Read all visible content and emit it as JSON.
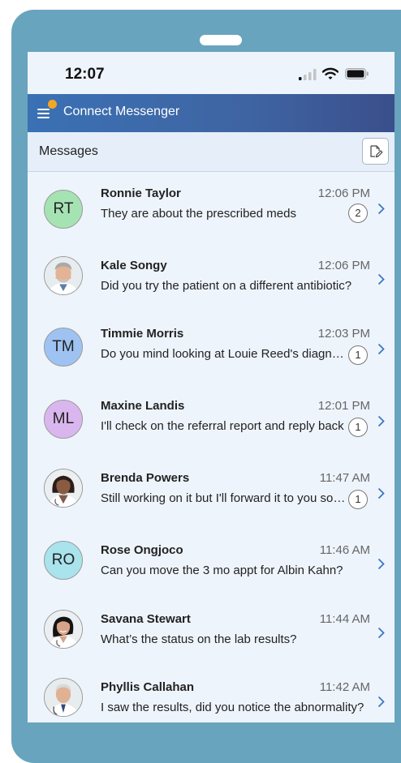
{
  "status_bar": {
    "time": "12:07"
  },
  "app": {
    "title": "Connect Messenger"
  },
  "subheader": {
    "title": "Messages"
  },
  "messages": [
    {
      "initials": "RT",
      "name": "Ronnie Taylor",
      "time": "12:06 PM",
      "preview": "They are about the prescribed meds",
      "unread": "2",
      "avatar_color": "#a6e3b3"
    },
    {
      "name": "Kale Songy",
      "time": "12:06 PM",
      "preview": "Did you try the patient on a different antibiotic?",
      "photo": "male-doctor-gray-hair"
    },
    {
      "initials": "TM",
      "name": "Timmie Morris",
      "time": "12:03 PM",
      "preview": "Do you mind looking at Louie Reed's diagnosis?",
      "unread": "1",
      "avatar_color": "#9ec3f3"
    },
    {
      "initials": "ML",
      "name": "Maxine Landis",
      "time": "12:01 PM",
      "preview": "I'll check on the referral report and reply back",
      "unread": "1",
      "avatar_color": "#d9b7ee"
    },
    {
      "name": "Brenda Powers",
      "time": "11:47 AM",
      "preview": "Still working on it but I'll forward it to you soon",
      "unread": "1",
      "photo": "female-doctor-dark-hair"
    },
    {
      "initials": "RO",
      "name": "Rose Ongjoco",
      "time": "11:46 AM",
      "preview": "Can you move the 3 mo appt for Albin Kahn?",
      "avatar_color": "#a9e3ec"
    },
    {
      "name": "Savana Stewart",
      "time": "11:44 AM",
      "preview": "What’s the status on the lab results?",
      "photo": "female-doctor-black-hair"
    },
    {
      "name": "Phyllis Callahan",
      "time": "11:42 AM",
      "preview": "I saw the results, did you notice the abnormality?",
      "photo": "male-doctor-white-hair"
    }
  ],
  "colors": {
    "device": "#68a4bd",
    "appbar": "#3f64a2",
    "accent_dot": "#f5a623",
    "chevron": "#3a78c2"
  },
  "icons": [
    "menu-icon",
    "compose-icon",
    "signal-icon",
    "wifi-icon",
    "battery-icon",
    "chevron-right-icon"
  ]
}
